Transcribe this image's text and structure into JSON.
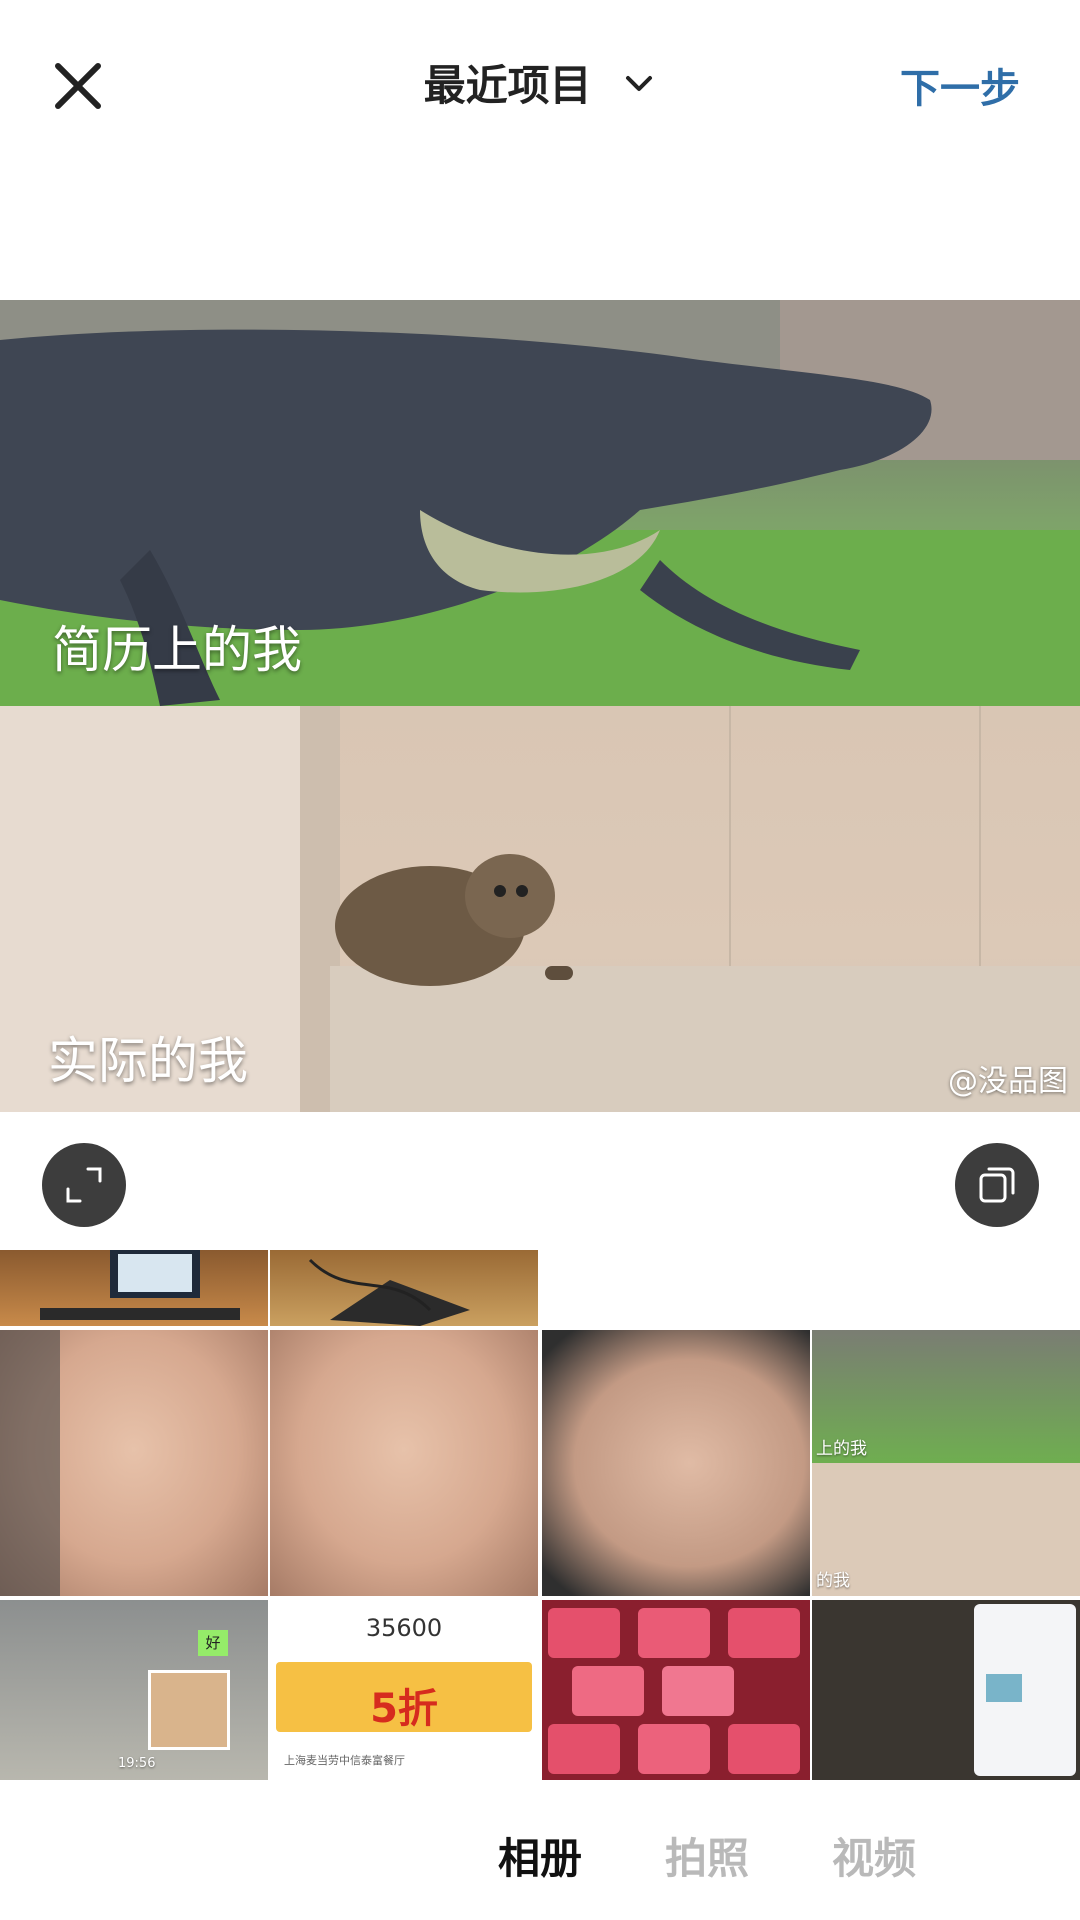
{
  "header": {
    "close_icon": "close-icon",
    "title": "最近项目",
    "chevron_icon": "chevron-down-icon",
    "next_label": "下一步"
  },
  "preview": {
    "top_caption": "简历上的我",
    "bottom_caption": "实际的我",
    "watermark": "@没品图"
  },
  "actions": {
    "expand_icon": "expand-icon",
    "multi_select_icon": "multi-select-icon"
  },
  "grid": {
    "selected_tile_top_label": "上的我",
    "selected_tile_bottom_label": "的我",
    "chat_tag": "好",
    "chat_time": "19:56",
    "receipt_number": "35600",
    "receipt_promo": "5折",
    "receipt_address": "上海麦当劳中信泰富餐厅"
  },
  "tabs": [
    "相册",
    "拍照",
    "视频"
  ],
  "colors": {
    "accent": "#2f6ea8",
    "inactive_tab": "#b9b9b9",
    "button_bg": "#3d3d3d"
  }
}
